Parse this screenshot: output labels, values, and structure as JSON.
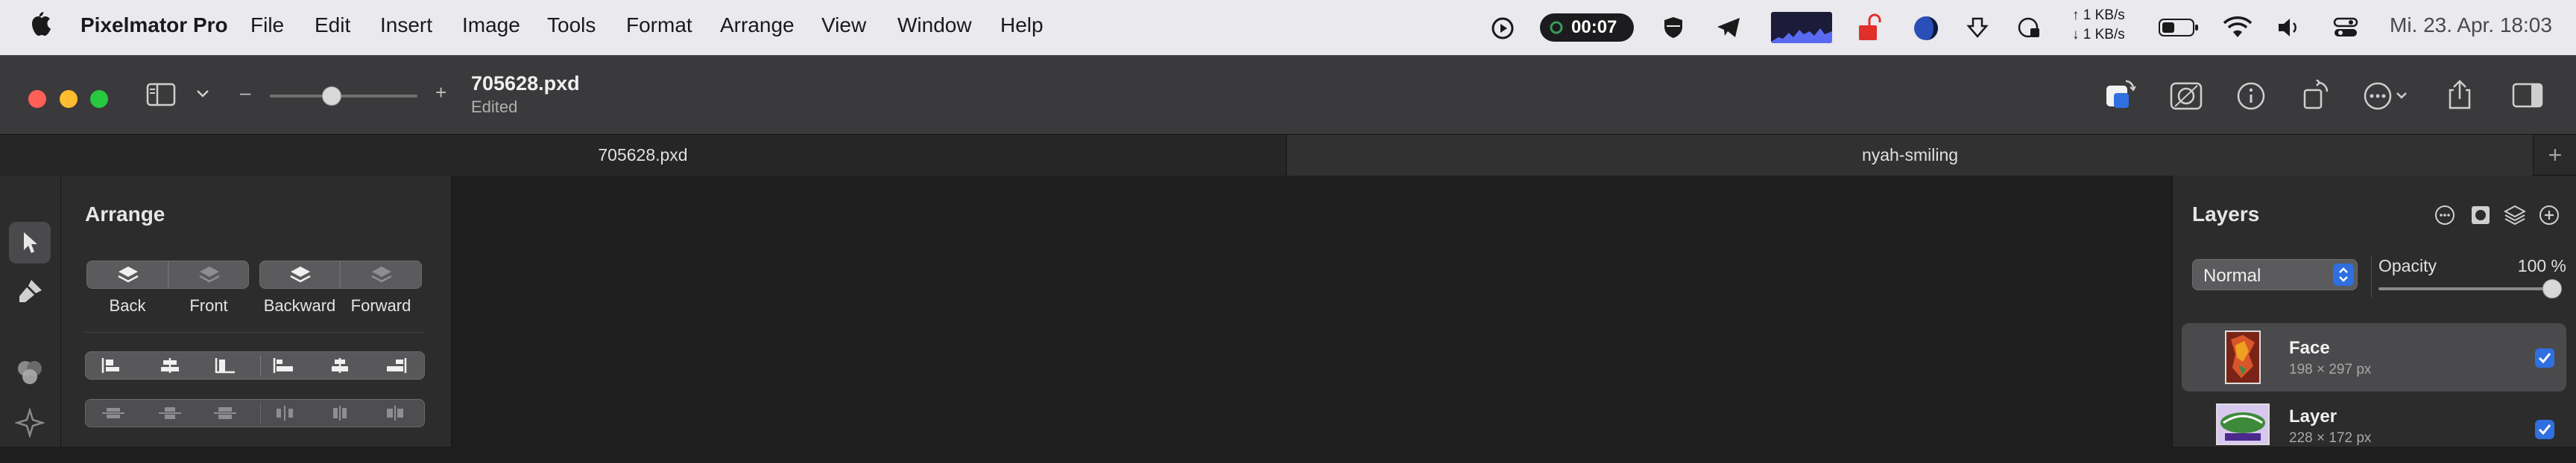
{
  "menubar": {
    "app_name": "Pixelmator Pro",
    "items": [
      "File",
      "Edit",
      "Insert",
      "Image",
      "Tools",
      "Format",
      "Arrange",
      "View",
      "Window",
      "Help"
    ],
    "timer": "00:07",
    "net_up": "↑ 1 KB/s",
    "net_down": "↓ 1 KB/s",
    "clock": "Mi. 23. Apr.  18:03"
  },
  "toolbar": {
    "doc_title": "705628.pxd",
    "doc_status": "Edited",
    "zoom_minus": "–",
    "zoom_plus": "+",
    "zoom_level": 0.42
  },
  "tabs": [
    {
      "label": "705628.pxd",
      "active": true
    },
    {
      "label": "nyah-smiling",
      "active": false
    }
  ],
  "tabs_add": "+",
  "arrange": {
    "title": "Arrange",
    "buttons": [
      {
        "label": "Back",
        "enabled": true
      },
      {
        "label": "Front",
        "enabled": false
      },
      {
        "label": "Backward",
        "enabled": true
      },
      {
        "label": "Forward",
        "enabled": false
      }
    ]
  },
  "layers": {
    "title": "Layers",
    "blend_mode": "Normal",
    "opacity_label": "Opacity",
    "opacity_value": "100 %",
    "items": [
      {
        "name": "Face",
        "size": "198 × 297 px",
        "visible": true,
        "selected": true
      },
      {
        "name": "Layer",
        "size": "228 × 172 px",
        "visible": true,
        "selected": false
      }
    ]
  },
  "colors": {
    "accent": "#2f6fe0",
    "close": "#ff5f57",
    "minimize": "#febc2e",
    "zoom": "#28c840",
    "recording_red": "#e0302a"
  }
}
